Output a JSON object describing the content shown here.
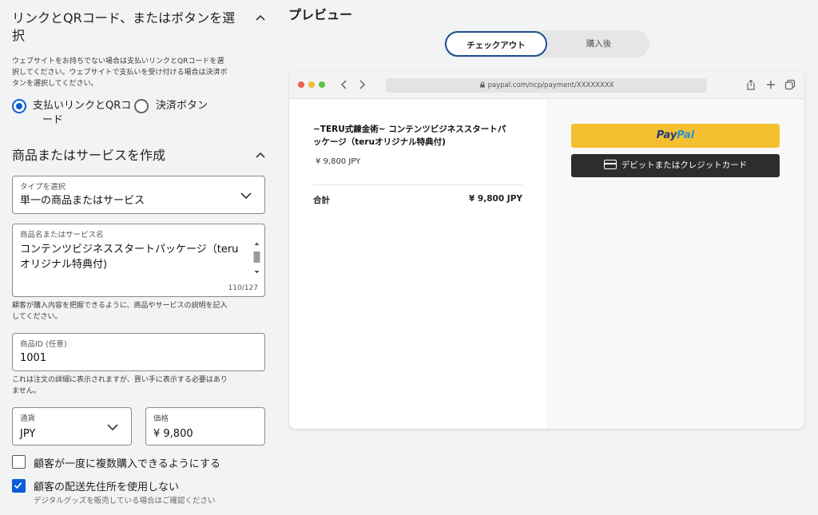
{
  "link_section": {
    "title_line1": "リンクとQRコード、またはボタンを選",
    "title_line2": "択",
    "help_line1": "ウェブサイトをお持ちでない場合は支払いリンクとQRコードを選",
    "help_line2": "択してください。ウェブサイトで支払いを受け付ける場合は決済ボ",
    "help_line3": "タンを選択してください。",
    "radio_link_line1": "支払いリンクとQRコ",
    "radio_link_line2": "ード",
    "radio_link_selected": true,
    "radio_button_label": "決済ボタン"
  },
  "product_section": {
    "title": "商品またはサービスを作成",
    "type_label": "タイプを選択",
    "type_value": "単一の商品またはサービス",
    "name_label": "商品名またはサービス名",
    "name_value_line1": "コンテンツビジネススタートパッケージ（teru",
    "name_value_line2": "オリジナル特典付)",
    "name_counter": "110/127",
    "name_help_line1": "顧客が購入内容を把握できるように、商品やサービスの説明を記入",
    "name_help_line2": "してください。",
    "id_label": "商品ID (任意)",
    "id_value": "1001",
    "id_help_line1": "これは注文の詳細に表示されますが、買い手に表示する必要はあり",
    "id_help_line2": "ません。",
    "currency_label": "通貨",
    "currency_value": "JPY",
    "price_label": "価格",
    "price_value": "¥ 9,800",
    "multi_qty_label": "顧客が一度に複数購入できるようにする",
    "multi_qty_checked": false,
    "no_shipping_label": "顧客の配送先住所を使用しない",
    "no_shipping_checked": true,
    "no_shipping_sub": "デジタルグッズを販売している場合はご確認ください"
  },
  "preview": {
    "title": "プレビュー",
    "tab_checkout": "チェックアウト",
    "tab_after": "購入後",
    "url": "paypal.com/ncp/payment/XXXXXXXX",
    "item_name_line1": "~TERU式錬金術~ コンテンツビジネススタートパ",
    "item_name_line2": "ッケージ（teruオリジナル特典付)",
    "item_price": "¥ 9,800 JPY",
    "total_label": "合計",
    "total_value": "¥ 9,800 JPY",
    "paypal_pay": "Pay",
    "paypal_pal": "Pal",
    "card_button": "デビットまたはクレジットカード"
  },
  "colors": {
    "accent": "#0b5ed7",
    "paypal_yellow": "#f5c02f",
    "card_dark": "#2d2d2d"
  }
}
